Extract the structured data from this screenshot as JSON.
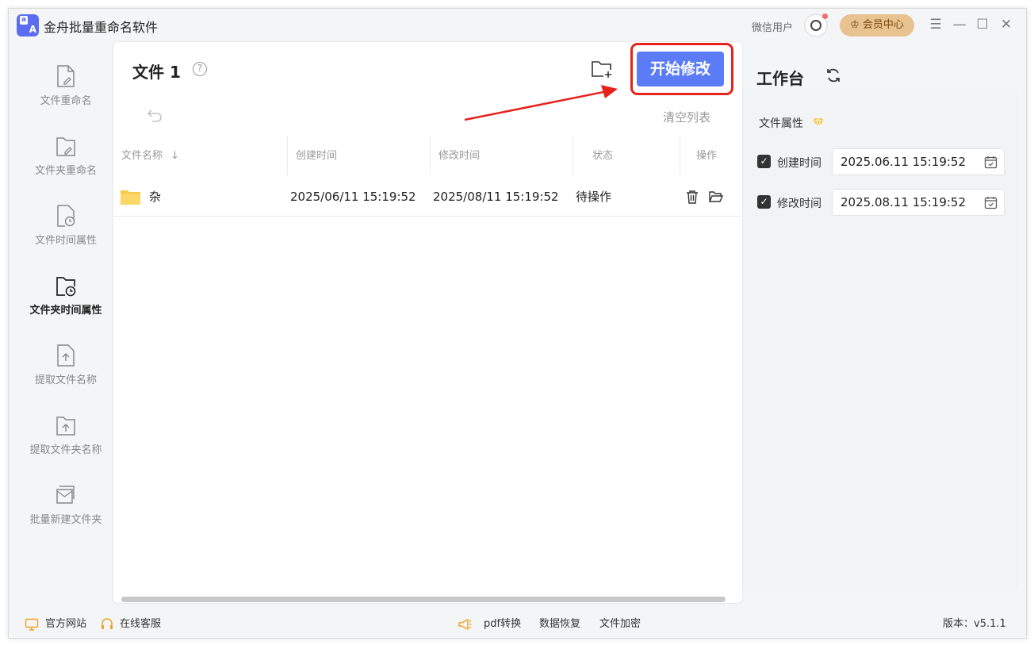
{
  "app": {
    "title": "金舟批量重命名软件",
    "logo_top": "a",
    "logo_bottom": "A"
  },
  "user": {
    "name": "微信用户",
    "vip_label": "会员中心"
  },
  "window_controls": {
    "menu": "☰",
    "minimize": "—",
    "maximize": "☐",
    "close": "✕"
  },
  "sidebar": {
    "items": [
      {
        "label": "文件重命名",
        "icon": "file-edit-icon",
        "active": false
      },
      {
        "label": "文件夹重命名",
        "icon": "folder-edit-icon",
        "active": false
      },
      {
        "label": "文件时间属性",
        "icon": "file-clock-icon",
        "active": false
      },
      {
        "label": "文件夹时间属性",
        "icon": "folder-clock-icon",
        "active": true
      },
      {
        "label": "提取文件名称",
        "icon": "file-upload-icon",
        "active": false
      },
      {
        "label": "提取文件夹名称",
        "icon": "folder-upload-icon",
        "active": false
      },
      {
        "label": "批量新建文件夹",
        "icon": "new-folders-icon",
        "active": false
      }
    ]
  },
  "main": {
    "title": "文件 1",
    "help": "?",
    "start_button": "开始修改",
    "clear_list": "清空列表",
    "columns": [
      "文件名称",
      "创建时间",
      "修改时间",
      "状态",
      "操作"
    ],
    "rows": [
      {
        "name": "杂",
        "created": "2025/06/11 15:19:52",
        "modified": "2025/08/11 15:19:52",
        "status": "待操作"
      }
    ]
  },
  "workbench": {
    "title": "工作台",
    "section_title": "文件属性",
    "fields": [
      {
        "label": "创建时间",
        "checked": true,
        "value": "2025.06.11 15:19:52"
      },
      {
        "label": "修改时间",
        "checked": true,
        "value": "2025.08.11 15:19:52"
      }
    ]
  },
  "footer": {
    "website": "官方网站",
    "support": "在线客服",
    "pdf": "pdf转换",
    "recovery": "数据恢复",
    "encrypt": "文件加密",
    "version": "版本：v5.1.1"
  },
  "colors": {
    "accent": "#5b7cf6",
    "highlight": "#e5231b",
    "vip": "#e8c28f",
    "folder": "#f7c948"
  }
}
